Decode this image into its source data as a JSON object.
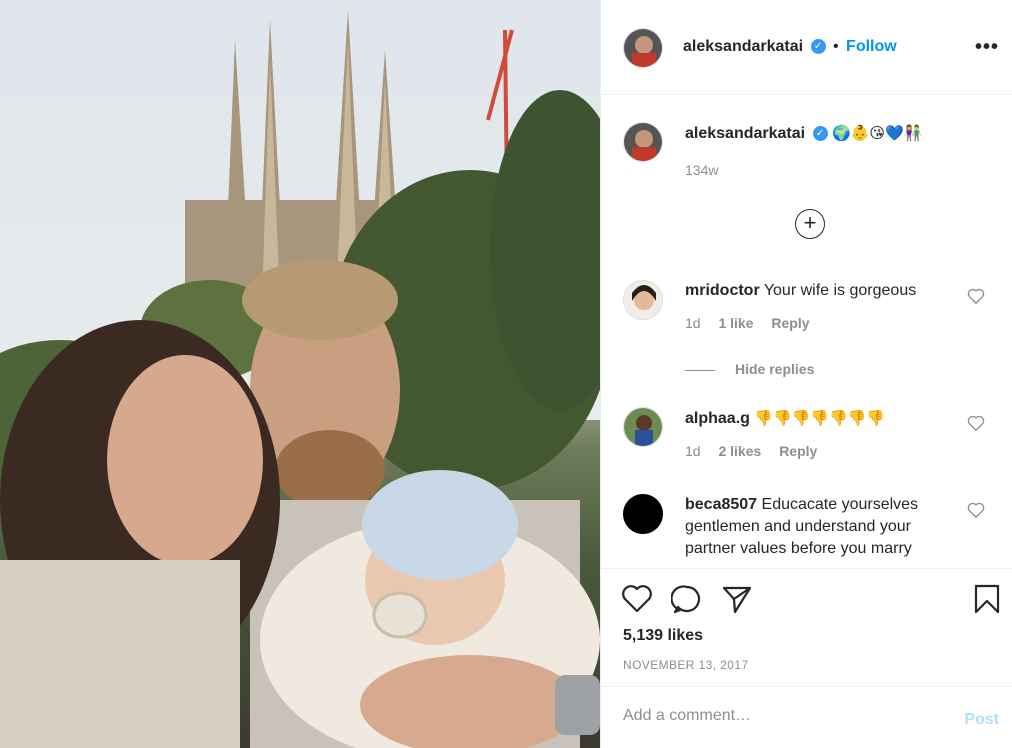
{
  "post": {
    "username": "aleksandarkatai",
    "follow_label": "Follow",
    "more_label": "•••",
    "caption_emojis": "🌍👶😘💙👫",
    "caption_time": "134w",
    "likes": "5,139 likes",
    "date": "NOVEMBER 13, 2017"
  },
  "comments": [
    {
      "username": "mridoctor",
      "text": "Your wife is gorgeous",
      "time": "1d",
      "likes": "1 like",
      "reply": "Reply"
    },
    {
      "username": "alphaa.g",
      "text": "👎👎👎👎👎👎👎",
      "time": "1d",
      "likes": "2 likes",
      "reply": "Reply"
    },
    {
      "username": "beca8507",
      "text": "Educacate yourselves gentlemen and understand your partner values before you marry"
    }
  ],
  "hide_replies": "Hide replies",
  "add_comment": {
    "placeholder": "Add a comment…",
    "post_label": "Post"
  },
  "colors": {
    "link": "#0095f6",
    "verified": "#3897f0",
    "muted": "#8e8e8e"
  }
}
